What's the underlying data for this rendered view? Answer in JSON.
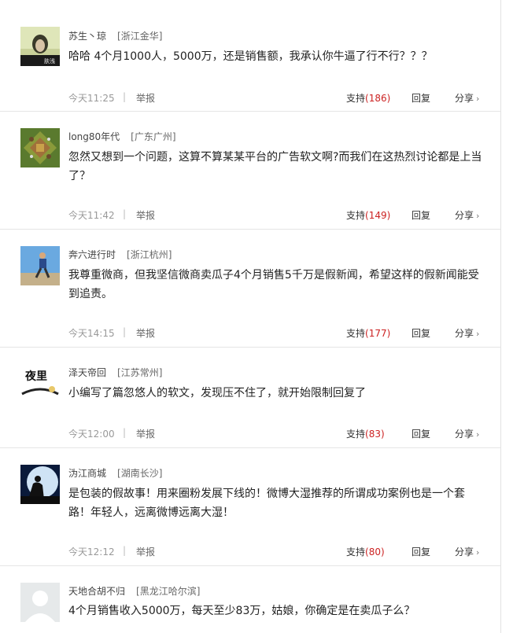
{
  "comments": [
    {
      "user": "苏生丶琼",
      "location": "[浙江金华]",
      "avatar_text": "肤浅",
      "text": "哈哈 4个月1000人，5000万，还是销售额，我承认你牛逼了行不行？？？",
      "time": "今天11:25",
      "report": "举报",
      "support": "支持",
      "count": "(186)",
      "reply": "回复",
      "share": "分享"
    },
    {
      "user": "long80年代",
      "location": "[广东广州]",
      "text": "忽然又想到一个问题，这算不算某某平台的广告软文啊?而我们在这热烈讨论都是上当了？",
      "time": "今天11:42",
      "report": "举报",
      "support": "支持",
      "count": "(149)",
      "reply": "回复",
      "share": "分享"
    },
    {
      "user": "奔六进行时",
      "location": "[浙江杭州]",
      "text": "我尊重微商，但我坚信微商卖瓜子4个月销售5千万是假新闻，希望这样的假新闻能受到追责。",
      "time": "今天14:15",
      "report": "举报",
      "support": "支持",
      "count": "(177)",
      "reply": "回复",
      "share": "分享"
    },
    {
      "user": "泽天帝回",
      "location": "[江苏常州]",
      "avatar_text": "夜里",
      "text": "小编写了篇忽悠人的软文，发现压不住了，就开始限制回复了",
      "time": "今天12:00",
      "report": "举报",
      "support": "支持",
      "count": "(83)",
      "reply": "回复",
      "share": "分享"
    },
    {
      "user": "沩江商城",
      "location": "[湖南长沙]",
      "text": "是包装的假故事！用来圈粉发展下线的！微博大湿推荐的所谓成功案例也是一个套路！年轻人，远离微博远离大湿！",
      "time": "今天12:12",
      "report": "举报",
      "support": "支持",
      "count": "(80)",
      "reply": "回复",
      "share": "分享"
    },
    {
      "user": "天地合胡不归",
      "location": "[黑龙江哈尔滨]",
      "text": "4个月销售收入5000万，每天至少83万，姑娘，你确定是在卖瓜子么？",
      "time": "",
      "report": "",
      "support": "",
      "count": "",
      "reply": "",
      "share": ""
    }
  ]
}
